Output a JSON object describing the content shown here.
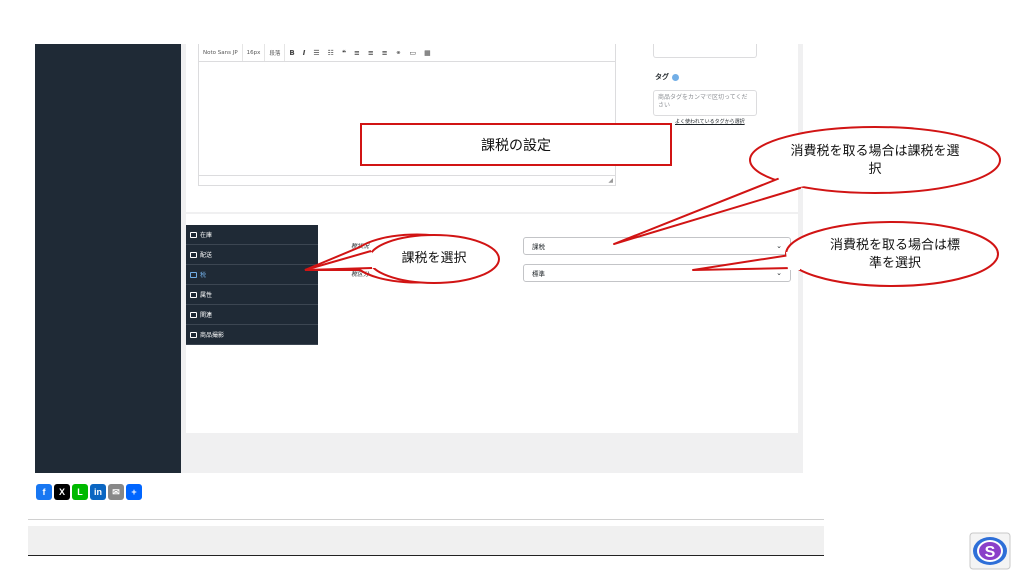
{
  "editor": {
    "toolbar": {
      "font": "Noto Sans JP",
      "size": "16px",
      "format": "段落"
    }
  },
  "tags": {
    "title": "タグ",
    "placeholder": "商品タグをカンマで区切ってください",
    "frequent_link": "よく使われているタグから選択"
  },
  "product_data": {
    "tabs": [
      {
        "label": "在庫",
        "icon": "database-icon"
      },
      {
        "label": "配送",
        "icon": "truck-icon"
      },
      {
        "label": "税",
        "icon": "tax-icon"
      },
      {
        "label": "属性",
        "icon": "list-icon"
      },
      {
        "label": "関連",
        "icon": "link-icon"
      },
      {
        "label": "商品撮影",
        "icon": "camera-icon"
      }
    ],
    "active_tab": 2,
    "tax_status": {
      "label": "税状況",
      "value": "課税"
    },
    "tax_class": {
      "label": "税区分",
      "value": "標準"
    }
  },
  "annotations": {
    "title_box": "課税の設定",
    "callout_select": "課税を選択",
    "callout_status": "消費税を取る場合は課税を選択",
    "callout_class": "消費税を取る場合は標準を選択",
    "color": "#d11414"
  },
  "share": {
    "buttons": [
      {
        "name": "facebook",
        "glyph": "f",
        "color": "#1877f2"
      },
      {
        "name": "x",
        "glyph": "X",
        "color": "#000000"
      },
      {
        "name": "line",
        "glyph": "L",
        "color": "#00b900"
      },
      {
        "name": "linkedin",
        "glyph": "in",
        "color": "#0a66c2"
      },
      {
        "name": "email",
        "glyph": "✉",
        "color": "#888888"
      },
      {
        "name": "more",
        "glyph": "+",
        "color": "#0166ff"
      }
    ]
  },
  "logo": {
    "letter": "S"
  }
}
